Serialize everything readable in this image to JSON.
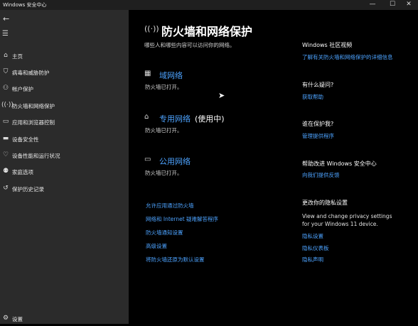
{
  "window": {
    "title": "Windows 安全中心",
    "minimize": "—",
    "maximize": "☐",
    "close": "✕"
  },
  "sidebar": {
    "items": [
      {
        "label": "主页",
        "icon": "home-icon"
      },
      {
        "label": "病毒和威胁防护",
        "icon": "shield-icon"
      },
      {
        "label": "帐户保护",
        "icon": "person-icon"
      },
      {
        "label": "防火墙和网络保护",
        "icon": "wifi-icon"
      },
      {
        "label": "应用和浏览器控制",
        "icon": "app-window-icon"
      },
      {
        "label": "设备安全性",
        "icon": "laptop-icon"
      },
      {
        "label": "设备性能和运行状况",
        "icon": "heart-icon"
      },
      {
        "label": "家庭选项",
        "icon": "family-icon"
      },
      {
        "label": "保护历史记录",
        "icon": "history-icon"
      }
    ],
    "settings_label": "设置"
  },
  "main": {
    "title": "防火墙和网络保护",
    "subtitle": "哪些人和哪些内容可以访问你的网络。",
    "networks": [
      {
        "name": "域网络",
        "suffix": "",
        "status": "防火墙已打开。",
        "icon": "domain-network-icon"
      },
      {
        "name": "专用网络",
        "suffix": "(使用中)",
        "status": "防火墙已打开。",
        "icon": "private-network-icon"
      },
      {
        "name": "公用网络",
        "suffix": "",
        "status": "防火墙已打开。",
        "icon": "public-network-icon"
      }
    ],
    "links": [
      "允许应用通过防火墙",
      "网络和 Internet 疑难解答程序",
      "防火墙通知设置",
      "高级设置",
      "将防火墙还原为默认设置"
    ]
  },
  "right_panel": {
    "community_heading": "Windows 社区视频",
    "community_link": "了解有关防火墙和网络保护的详细信息",
    "question_heading": "有什么疑问?",
    "question_link": "获取帮助",
    "protect_heading": "谁在保护我?",
    "protect_link": "管理提供程序",
    "improve_heading": "帮助改进 Windows 安全中心",
    "improve_link": "向我们提供反馈",
    "privacy_heading": "更改你的隐私设置",
    "privacy_text_1": "View and change privacy settings",
    "privacy_text_2": "for your Windows 11 device.",
    "privacy_links": [
      "隐私设置",
      "隐私仪表板",
      "隐私声明"
    ]
  }
}
